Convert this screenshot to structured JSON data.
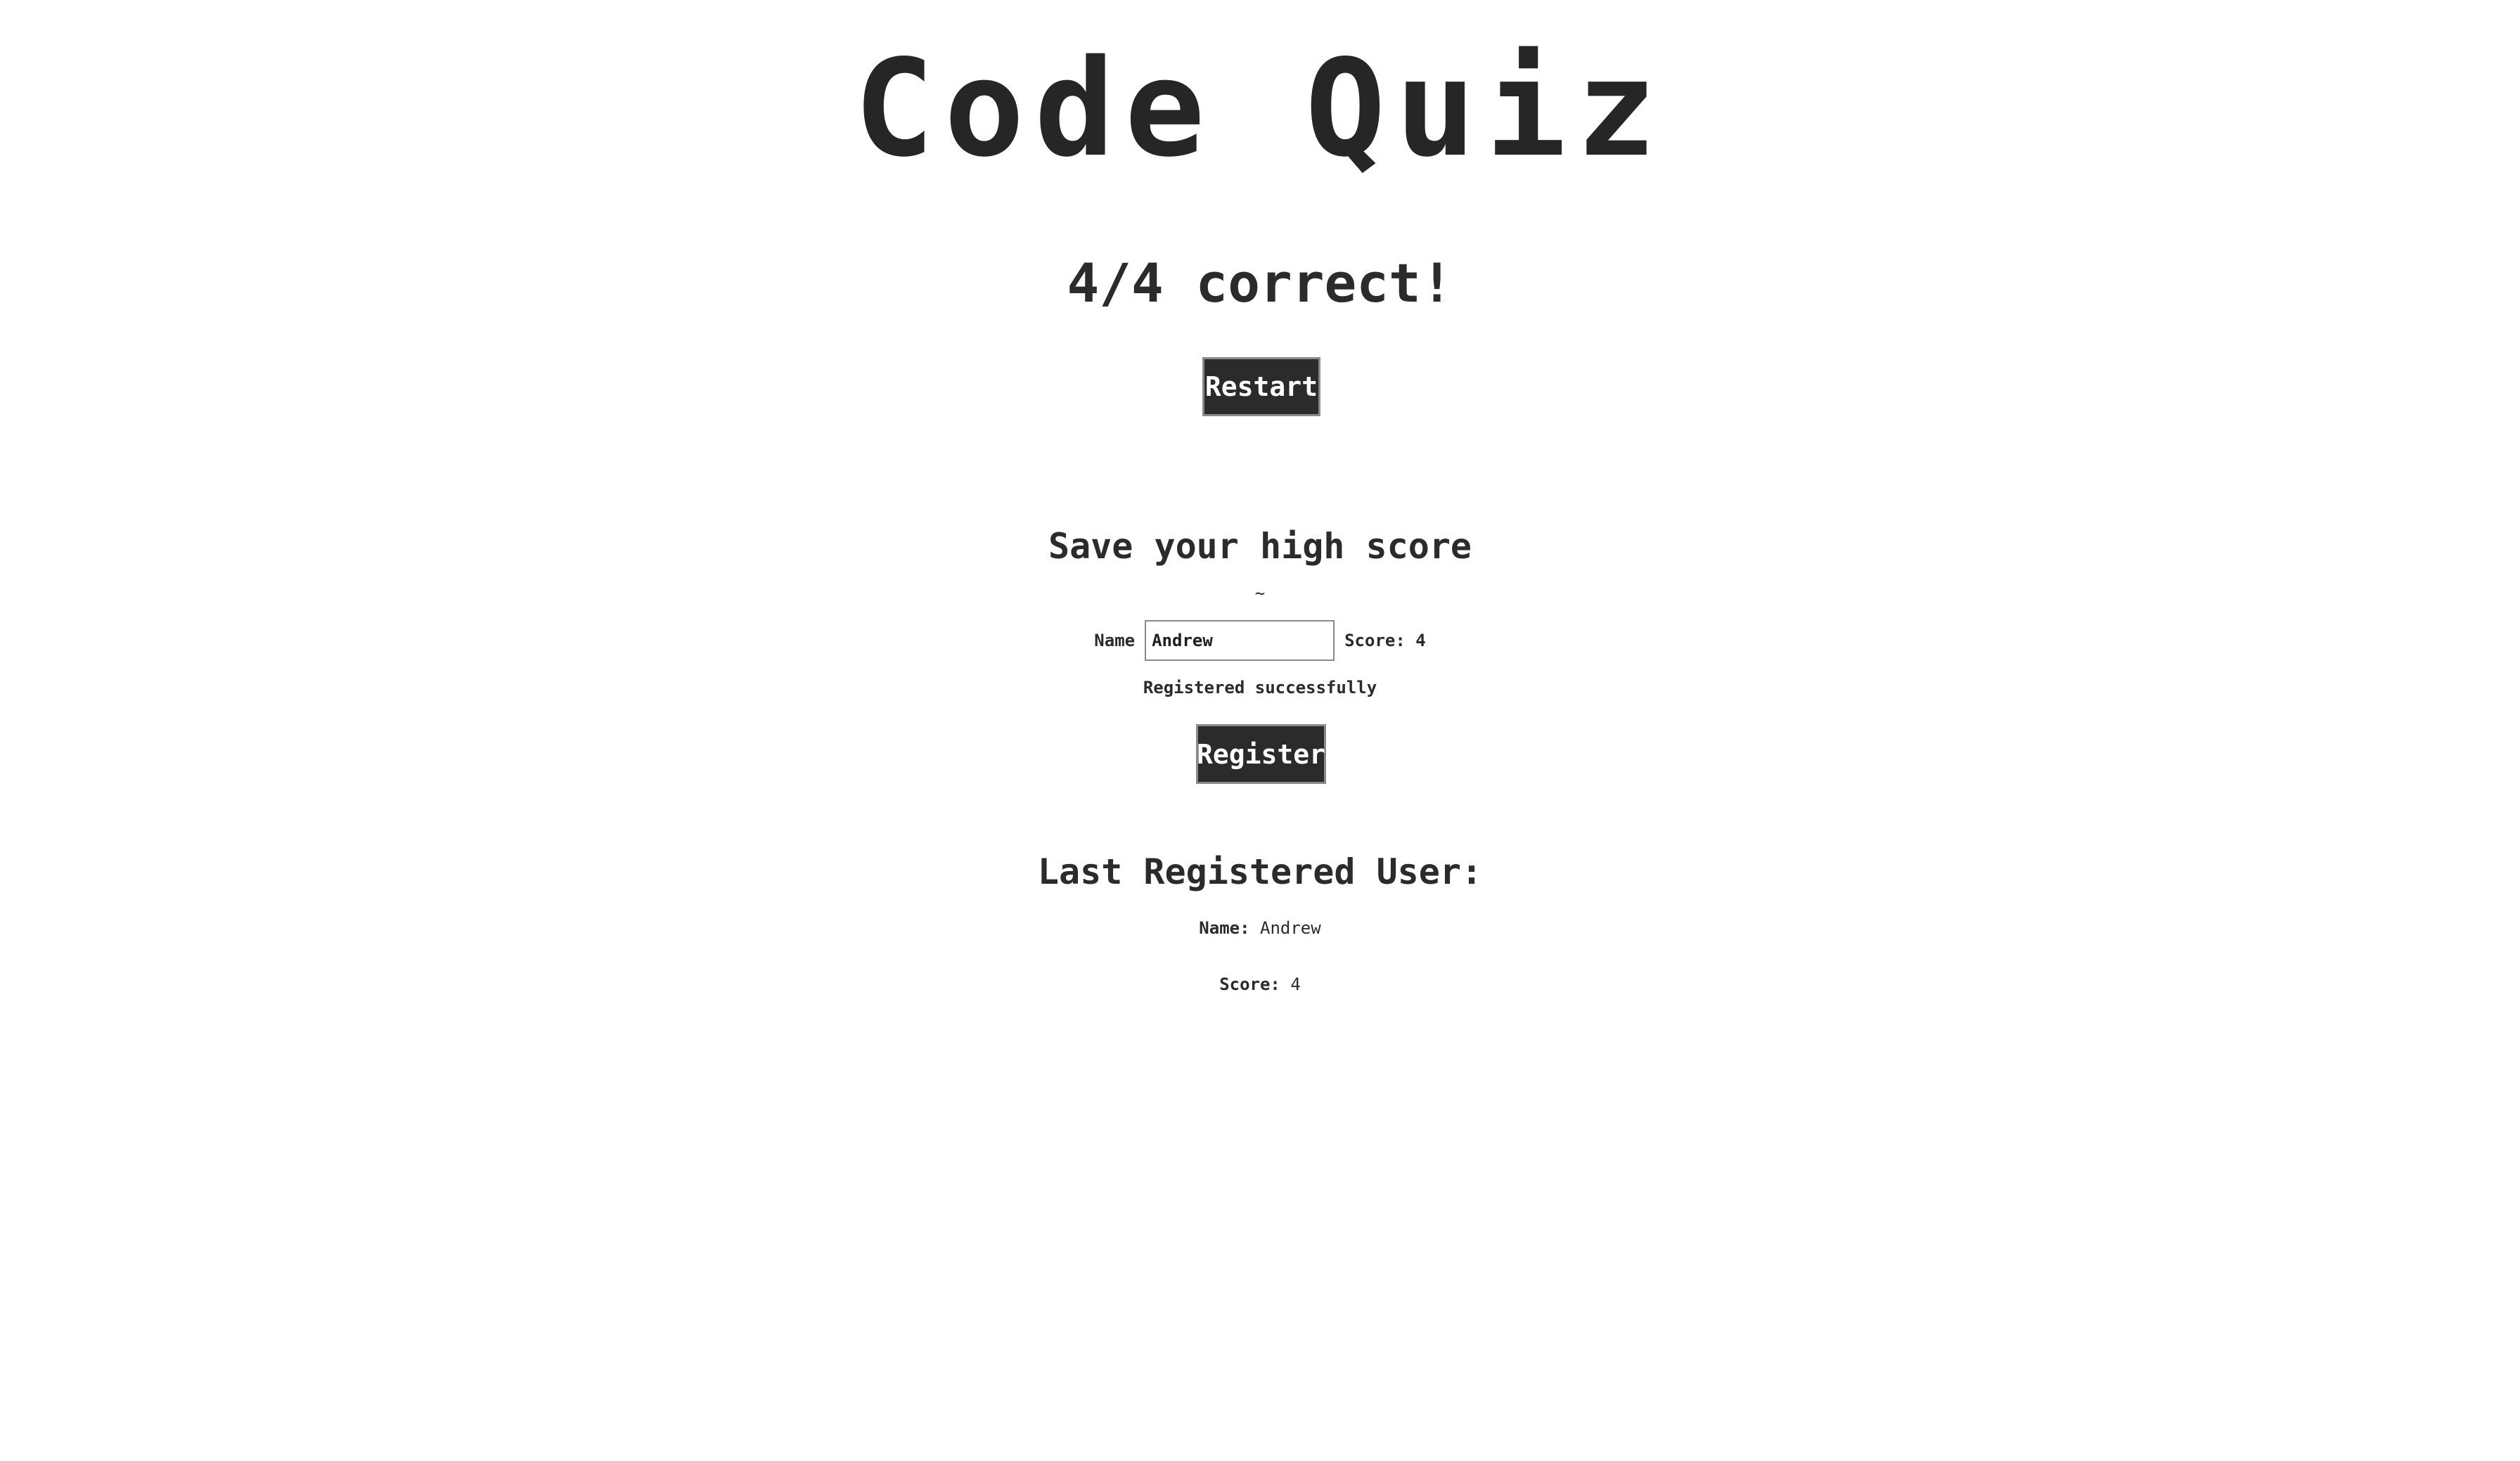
{
  "header": {
    "title": "Code Quiz"
  },
  "result": {
    "text": "4/4 correct!"
  },
  "restart": {
    "label": "Restart"
  },
  "highscore": {
    "title": "Save your high score",
    "decoration": "~",
    "name_label": "Name",
    "name_value": "Andrew",
    "score_text": "Score: 4",
    "status": "Registered successfully",
    "register_label": "Register"
  },
  "last_user": {
    "title": "Last Registered User:",
    "name_key": "Name:",
    "name_value": "Andrew",
    "score_key": "Score:",
    "score_value": "4"
  },
  "colors": {
    "text": "#2b2b2b",
    "button_bg": "#2b2b2b",
    "button_text": "#ffffff",
    "background": "#ffffff"
  }
}
